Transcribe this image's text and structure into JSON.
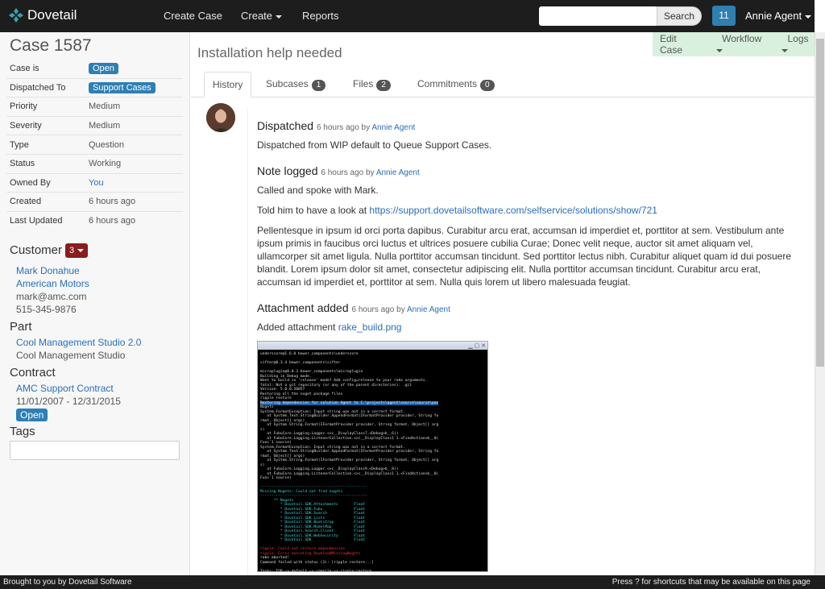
{
  "nav": {
    "brand": "Dovetail",
    "create_case": "Create Case",
    "create": "Create",
    "reports": "Reports",
    "search_placeholder": "",
    "search_button": "Search",
    "notification_count": "11",
    "user": "Annie Agent"
  },
  "case": {
    "title": "Case 1587",
    "issue_title": "Installation help needed",
    "properties": [
      {
        "label": "Case is",
        "value": "Open"
      },
      {
        "label": "Dispatched To",
        "value": "Support Cases"
      },
      {
        "label": "Priority",
        "value": "Medium"
      },
      {
        "label": "Severity",
        "value": "Medium"
      },
      {
        "label": "Type",
        "value": "Question"
      },
      {
        "label": "Status",
        "value": "Working"
      },
      {
        "label": "Owned By",
        "value": "You"
      },
      {
        "label": "Created",
        "value": "6 hours ago"
      },
      {
        "label": "Last Updated",
        "value": "6 hours ago"
      }
    ]
  },
  "customer": {
    "heading": "Customer",
    "count": "3",
    "name": "Mark Donahue",
    "company": "American Motors",
    "email": "mark@amc.com",
    "phone": "515-345-9876"
  },
  "part": {
    "heading": "Part",
    "name": "Cool Management Studio 2.0",
    "family": "Cool Management Studio"
  },
  "contract": {
    "heading": "Contract",
    "name": "AMC Support Contract",
    "dates": "11/01/2007 - 12/31/2015",
    "status": "Open"
  },
  "tags": {
    "heading": "Tags"
  },
  "actions": {
    "edit": "Edit Case",
    "workflow": "Workflow",
    "logs": "Logs"
  },
  "tabs": [
    {
      "label": "History",
      "count": ""
    },
    {
      "label": "Subcases",
      "count": "1"
    },
    {
      "label": "Files",
      "count": "2"
    },
    {
      "label": "Commitments",
      "count": "0"
    }
  ],
  "events": {
    "dispatched": {
      "title": "Dispatched",
      "time": "6 hours ago",
      "by": "by",
      "agent": "Annie Agent",
      "text": "Dispatched from WIP default to Queue Support Cases."
    },
    "note": {
      "title": "Note logged",
      "time": "6 hours ago",
      "by": "by",
      "agent": "Annie Agent",
      "line1": "Called and spoke with Mark.",
      "line2_prefix": "Told him to have a look at",
      "line2_link": "https://support.dovetailsoftware.com/selfservice/solutions/show/721",
      "lorem": "Pellentesque in ipsum id orci porta dapibus. Curabitur arcu erat, accumsan id imperdiet et, porttitor at sem. Vestibulum ante ipsum primis in faucibus orci luctus et ultrices posuere cubilia Curae; Donec velit neque, auctor sit amet aliquam vel, ullamcorper sit amet ligula. Nulla porttitor accumsan tincidunt. Sed porttitor lectus nibh. Curabitur aliquet quam id dui posuere blandit. Lorem ipsum dolor sit amet, consectetur adipiscing elit. Nulla porttitor accumsan tincidunt. Curabitur arcu erat, accumsan id imperdiet et, porttitor at sem. Nulla quis lorem ut libero malesuada feugiat."
    },
    "attachment": {
      "title": "Attachment added",
      "time": "6 hours ago",
      "by": "by",
      "agent": "Annie Agent",
      "prefix": "Added attachment",
      "file": "rake_build.png"
    }
  },
  "footer": {
    "left": "Brought to you by Dovetail Software",
    "right": "Press ? for shortcuts that may be available on this page"
  },
  "colors": {
    "accent": "#2e7fb4",
    "customer_badge": "#8a1c1c",
    "action_bar": "#d9f0de"
  }
}
